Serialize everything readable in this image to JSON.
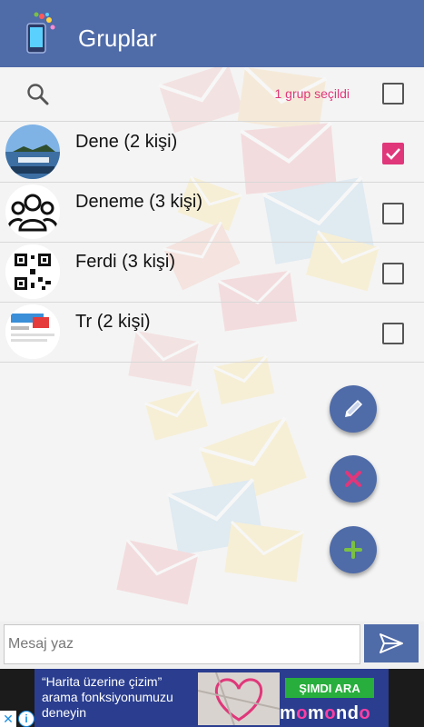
{
  "appbar": {
    "title": "Gruplar",
    "logo_icon": "phone-messages-icon"
  },
  "search": {
    "icon": "search-icon",
    "selected_text": "1 grup seçildi"
  },
  "groups": [
    {
      "name": "Dene  (2 kişi)",
      "checked": true,
      "avatar": "landscape-photo"
    },
    {
      "name": "Deneme (3 kişi)",
      "checked": false,
      "avatar": "people-icon"
    },
    {
      "name": "Ferdi  (3 kişi)",
      "checked": false,
      "avatar": "qr-code"
    },
    {
      "name": "Tr  (2 kişi)",
      "checked": false,
      "avatar": "web-screenshot"
    }
  ],
  "fabs": {
    "edit_icon": "pencil-icon",
    "delete_icon": "close-icon",
    "add_icon": "plus-icon"
  },
  "compose": {
    "placeholder": "Mesaj yaz",
    "send_icon": "send-icon"
  },
  "ad": {
    "text": "“Harita üzerine çizim” arama fonksiyonumuzu deneyin",
    "cta": "ŞIMDI ARA",
    "brand_part1": "m",
    "brand_o1": "o",
    "brand_part2": "m",
    "brand_o2": "o",
    "brand_part3": "nd",
    "brand_o3": "o",
    "close_glyph": "✕",
    "info_glyph": "i"
  },
  "colors": {
    "primary": "#4f6ba8",
    "accent": "#e0377a",
    "delete": "#e0377a",
    "add": "#7ac143"
  }
}
